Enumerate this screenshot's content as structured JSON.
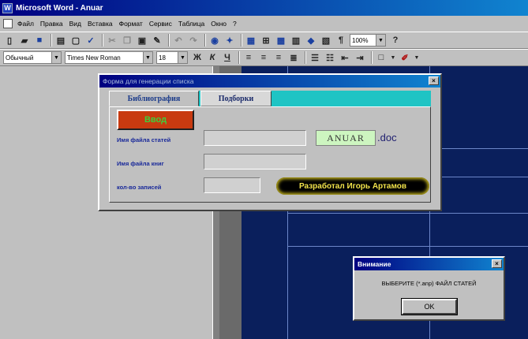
{
  "app": {
    "title": "Microsoft Word - Anuar",
    "icon_letter": "W"
  },
  "menu": [
    "Файл",
    "Правка",
    "Вид",
    "Вставка",
    "Формат",
    "Сервис",
    "Таблица",
    "Окно",
    "?"
  ],
  "toolbar": {
    "zoom": "100%",
    "style": "Обычный",
    "font": "Times New Roman",
    "size": "18"
  },
  "form": {
    "title": "Форма для генерации списка",
    "tabs": [
      "Библиография",
      "Подборки"
    ],
    "vvod_label": "Ввод",
    "labels": [
      "Имя файла статей",
      "Имя файла книг",
      "кол-во записей"
    ],
    "filename": "ANUAR",
    "ext": ".doc",
    "developer": "Разработал Игорь Артамов"
  },
  "alert": {
    "title": "Внимание",
    "message": "ВЫБЕРИТЕ (*.anp) ФАЙЛ СТАТЕЙ",
    "ok_label": "OK"
  },
  "icons": {
    "close": "×"
  }
}
